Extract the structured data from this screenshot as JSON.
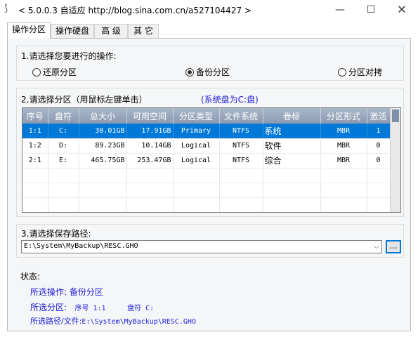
{
  "window": {
    "title": "< 5.0.0.3 自适应 http://blog.sina.com.cn/a527104427 >",
    "minimize": "—",
    "maximize": "☐",
    "close": "✕"
  },
  "tabs": [
    "操作分区",
    "操作硬盘",
    "高 级",
    "其 它"
  ],
  "operation": {
    "label": "1.请选择您要进行的操作:",
    "options": [
      "还原分区",
      "备份分区",
      "分区对拷"
    ],
    "selected": "备份分区"
  },
  "partitions": {
    "label": "2.请选择分区（用鼠标左键单击）",
    "system_disk": "(系统盘为C:盘)",
    "columns": [
      "序号",
      "盘符",
      "总大小",
      "可用空间",
      "分区类型",
      "文件系统",
      "卷标",
      "分区形式",
      "激活"
    ],
    "rows": [
      [
        "1:1",
        "C:",
        "30.01GB",
        "17.91GB",
        "Primary",
        "NTFS",
        "系统",
        "MBR",
        "1"
      ],
      [
        "1:2",
        "D:",
        "89.23GB",
        "10.14GB",
        "Logical",
        "NTFS",
        "软件",
        "MBR",
        "0"
      ],
      [
        "2:1",
        "E:",
        "465.75GB",
        "253.47GB",
        "Logical",
        "NTFS",
        "综合",
        "MBR",
        "0"
      ]
    ],
    "selected_row": 0
  },
  "save_path": {
    "label": "3.请选择保存路径:",
    "value": "E:\\System\\MyBackup\\RESC.GHO",
    "browse": "..."
  },
  "status": {
    "label": "状态:",
    "operation": "所选操作: 备份分区",
    "partition_prefix": "所选分区:",
    "partition_index": "序号 1:1",
    "partition_drive": "盘符 C:",
    "path_prefix": "所选路径/文件:",
    "path_value": "E:\\System\\MyBackup\\RESC.GHO"
  }
}
